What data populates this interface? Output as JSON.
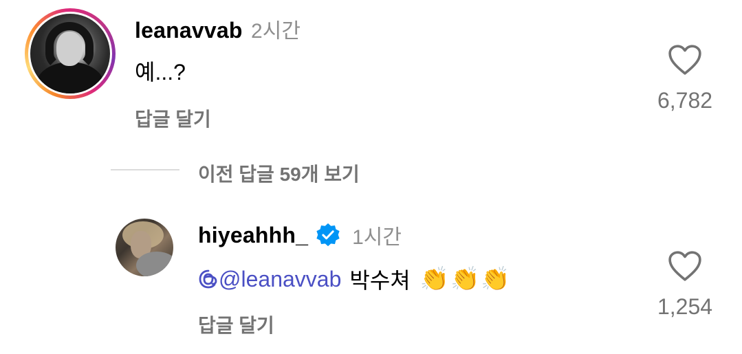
{
  "comments": [
    {
      "username": "leanavvab",
      "time": "2시간",
      "text": "예...?",
      "reply_label": "답글 달기",
      "likes": "6,782"
    },
    {
      "username": "hiyeahhh_",
      "verified": true,
      "time": "1시간",
      "mention": "@leanavvab",
      "text": "박수쳐",
      "emoji": "👏👏👏",
      "reply_label": "답글 달기",
      "likes": "1,254"
    }
  ],
  "view_more_replies": "이전 답글 59개 보기",
  "colors": {
    "mention": "#4a4fc4",
    "verified_badge": "#0095f6",
    "muted_text": "#737373"
  },
  "icons": {
    "like": "heart-outline-icon",
    "verified": "verified-badge-icon",
    "mention": "threads-at-icon"
  }
}
